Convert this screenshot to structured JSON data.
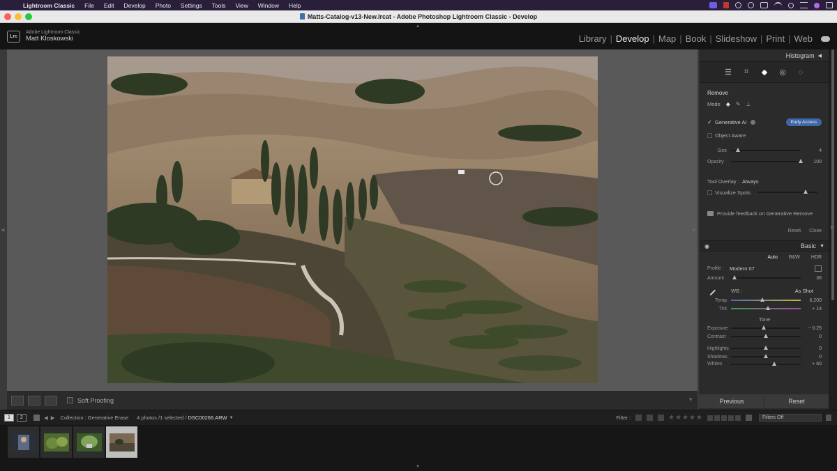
{
  "menubar": {
    "app_name": "Lightroom Classic",
    "items": [
      "File",
      "Edit",
      "Develop",
      "Photo",
      "Settings",
      "Tools",
      "View",
      "Window",
      "Help"
    ]
  },
  "window": {
    "title": "Matts-Catalog-v13-New.lrcat - Adobe Photoshop Lightroom Classic - Develop"
  },
  "identity": {
    "badge": "Lrc",
    "line1": "Adobe Lightroom Classic",
    "line2": "Matt Kloskowski"
  },
  "modules": {
    "items": [
      "Library",
      "Develop",
      "Map",
      "Book",
      "Slideshow",
      "Print",
      "Web"
    ],
    "active": "Develop"
  },
  "toolbar": {
    "soft_proofing": "Soft Proofing"
  },
  "right_panel": {
    "histogram_title": "Histogram",
    "remove": {
      "title": "Remove",
      "mode_label": "Mode",
      "generative_ai": "Generative AI",
      "early_access": "Early Access",
      "object_aware": "Object Aware",
      "size_label": "Size",
      "size_value": "4",
      "size_pos": 0.1,
      "opacity_label": "Opacity",
      "opacity_value": "100",
      "opacity_pos": 1.0,
      "tool_overlay_label": "Tool Overlay :",
      "tool_overlay_value": "Always",
      "visualize_spots": "Visualize Spots",
      "feedback": "Provide feedback on Generative Remove",
      "reset": "Reset",
      "close": "Close"
    },
    "basic": {
      "title": "Basic",
      "treatments": [
        "Auto",
        "B&W",
        "HDR"
      ],
      "profile_label": "Profile :",
      "profile_value": "Modern 07",
      "amount_label": "Amount",
      "amount_value": "36",
      "wb_label": "WB :",
      "wb_value": "As Shot",
      "temp_label": "Temp",
      "temp_value": "6,200",
      "tint_label": "Tint",
      "tint_value": "+ 14",
      "tone_label": "Tone",
      "sliders": [
        {
          "label": "Exposure",
          "value": "− 0.25"
        },
        {
          "label": "Contrast",
          "value": "0"
        },
        {
          "label": "Highlights",
          "value": "0"
        },
        {
          "label": "Shadows",
          "value": "0"
        },
        {
          "label": "Whites",
          "value": "+ 60"
        }
      ]
    },
    "previous": "Previous",
    "reset": "Reset"
  },
  "filmstrip_bar": {
    "view1": "1",
    "view2": "2",
    "collection_label": "Collection : Generative Erase",
    "count_text": "4 photos /1 selected /",
    "filename": "DSC00266.ARW",
    "filter_label": "Filter :",
    "filters_off": "Filters Off"
  },
  "colors": {
    "accent_blue": "#3e67a8",
    "panel_bg": "#2b2b2b",
    "viewer_bg": "#595959"
  }
}
